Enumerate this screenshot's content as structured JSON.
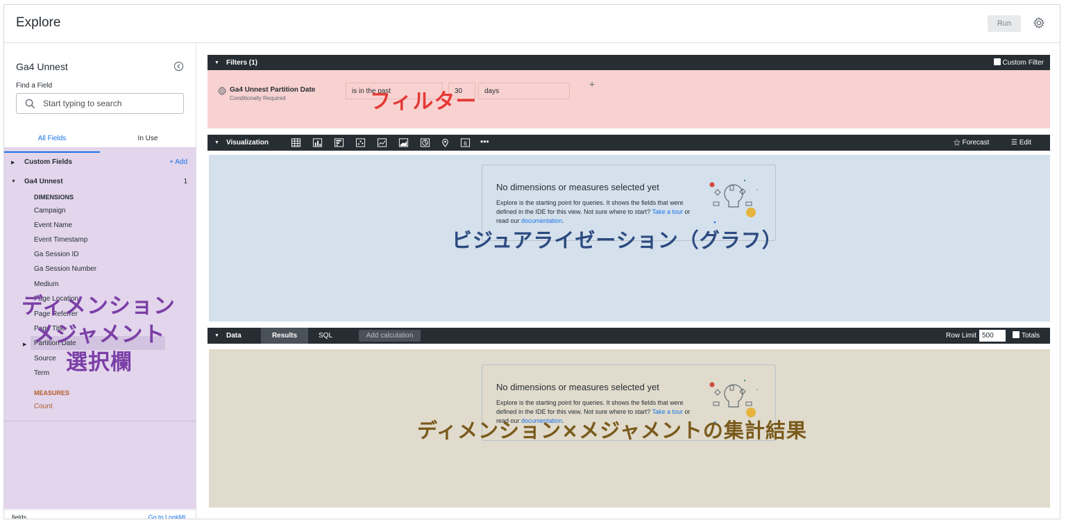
{
  "header": {
    "title": "Explore",
    "run_label": "Run"
  },
  "sidebar": {
    "explore_name": "Ga4 Unnest",
    "find_label": "Find a Field",
    "search_placeholder": "Start typing to search",
    "tabs": [
      "All Fields",
      "In Use"
    ],
    "custom_fields_label": "Custom Fields",
    "add_label": "+ Add",
    "view_label": "Ga4 Unnest",
    "view_count": "1",
    "dimensions_heading": "DIMENSIONS",
    "dimensions": [
      "Campaign",
      "Event Name",
      "Event Timestamp",
      "Ga Session ID",
      "Ga Session Number",
      "Medium",
      "Page Location",
      "Page Referrer",
      "Page Title",
      "Partition Date",
      "Source",
      "Term"
    ],
    "measures_heading": "MEASURES",
    "measures": [
      "Count"
    ],
    "footer_fields": "fields",
    "footer_link": "Go to LookML"
  },
  "annotations": {
    "sidebar_line1": "ディメンション",
    "sidebar_line2": "メジャメント",
    "sidebar_line3": "選択欄",
    "filter": "フィルター",
    "visualization": "ビジュアライゼーション（グラフ）",
    "data": "ディメンション×メジャメントの集計結果"
  },
  "filters": {
    "bar_title": "Filters (1)",
    "custom_filter_label": "Custom Filter",
    "field_name": "Ga4 Unnest Partition Date",
    "field_sub": "Conditionally Required",
    "operator": "is in the past",
    "value": "30",
    "unit": "days",
    "plus": "+"
  },
  "visualization": {
    "bar_title": "Visualization",
    "more": "•••",
    "forecast_label": "Forecast",
    "edit_label": "Edit",
    "icons": [
      "table-icon",
      "column-chart-icon",
      "bar-chart-icon",
      "scatter-icon",
      "line-chart-icon",
      "area-chart-icon",
      "pie-chart-icon",
      "map-pin-icon",
      "single-value-icon"
    ]
  },
  "empty_state": {
    "title": "No dimensions or measures selected yet",
    "desc": "Explore is the starting point for queries. It shows the fields that were defined in the IDE for this view. Not sure where to start?",
    "tour_link": "Take a tour",
    "or_read": " or read our ",
    "doc_link": "documentation",
    "period": "."
  },
  "data": {
    "bar_title": "Data",
    "tab_results": "Results",
    "tab_sql": "SQL",
    "add_calc": "Add calculation",
    "row_limit_label": "Row Limit",
    "row_limit_value": "500",
    "totals_label": "Totals"
  },
  "colors": {
    "filter_bg": "#f8d2d0",
    "viz_bg": "#d4e0ec",
    "data_bg": "#e0dbcc",
    "sidebar_bg": "#e2d5ec",
    "bar_dark": "#262d33",
    "link_blue": "#1a73e8"
  }
}
